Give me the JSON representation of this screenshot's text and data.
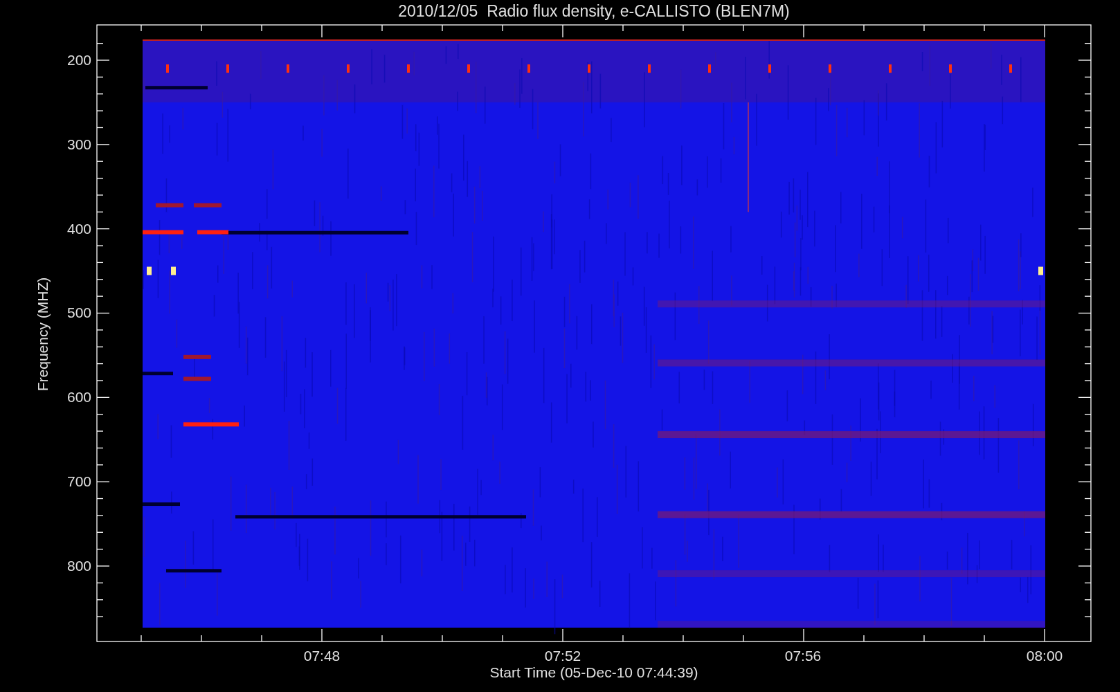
{
  "plot": {
    "title": "2010/12/05  Radio flux density, e-CALLISTO (BLEN7M)",
    "ylabel": "Frequency (MHZ)",
    "xlabel": "Start Time (05-Dec-10 07:44:39)",
    "yticks": [
      "200",
      "300",
      "400",
      "500",
      "600",
      "700",
      "800"
    ],
    "xticks": [
      "07:48",
      "07:52",
      "07:56",
      "08:00"
    ]
  }
}
